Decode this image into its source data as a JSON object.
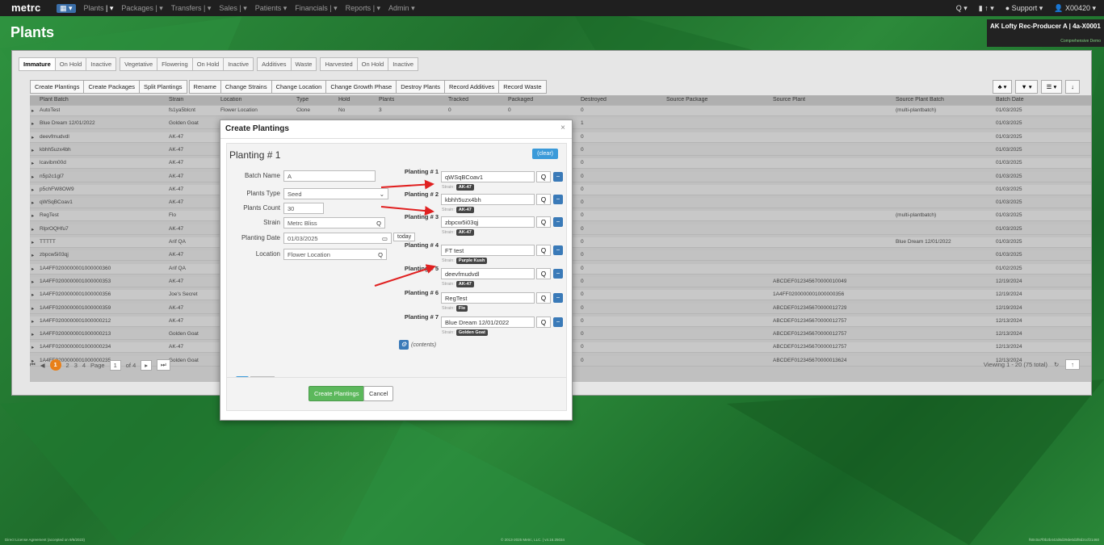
{
  "nav": {
    "logo": "metrc",
    "menu": [
      "Plants",
      "Packages",
      "Transfers",
      "Sales",
      "Patients",
      "Financials",
      "Reports",
      "Admin"
    ],
    "right": [
      "Q ▾",
      "▮ ↑ ▾",
      "● Support ▾",
      "👤 X00420 ▾"
    ]
  },
  "facility": {
    "name": "AK Lofty Rec-Producer A | 4a-X0001",
    "sub": "Comprehensive Demo"
  },
  "page_title": "Plants",
  "tabs": [
    "Immature",
    "On Hold",
    "Inactive",
    "Vegetative",
    "Flowering",
    "On Hold",
    "Inactive",
    "Additives",
    "Waste",
    "Harvested",
    "On Hold",
    "Inactive"
  ],
  "toolbar": [
    "Create Plantings",
    "Create Packages",
    "Split Plantings",
    "Rename",
    "Change Strains",
    "Change Location",
    "Change Growth Phase",
    "Destroy Plants",
    "Record Additives",
    "Record Waste"
  ],
  "toolbar_right": [
    "♣ ▾",
    "▼ ▾",
    "☰ ▾",
    "↓"
  ],
  "columns": [
    "Plant Batch",
    "Strain",
    "Location",
    "Type",
    "Hold",
    "Plants",
    "Tracked",
    "Packaged",
    "Destroyed",
    "Source Package",
    "Source Plant",
    "Source Plant Batch",
    "Batch Date"
  ],
  "rows": [
    {
      "batch": "AutoTest",
      "strain": "fs1ya5blcnt",
      "location": "Flower Location",
      "type": "Clone",
      "hold": "No",
      "plants": "3",
      "tracked": "0",
      "packaged": "0",
      "destroyed": "0",
      "src_plant": "",
      "src_batch": "(multi-plantbatch)",
      "date": "01/03/2025"
    },
    {
      "batch": "Blue Dream 12/01/2022",
      "strain": "Golden Goat",
      "location": "",
      "type": "",
      "hold": "",
      "plants": "",
      "tracked": "",
      "packaged": "",
      "destroyed": "1",
      "src_plant": "",
      "src_batch": "",
      "date": "01/03/2025"
    },
    {
      "batch": "deevfmudvdl",
      "strain": "AK-47",
      "destroyed": "0",
      "src_plant": "",
      "src_batch": "",
      "date": "01/03/2025"
    },
    {
      "batch": "kbhh5uzx4bh",
      "strain": "AK-47",
      "destroyed": "0",
      "src_plant": "",
      "src_batch": "",
      "date": "01/03/2025"
    },
    {
      "batch": "lcavibm00d",
      "strain": "AK-47",
      "destroyed": "0",
      "src_plant": "",
      "src_batch": "",
      "date": "01/03/2025"
    },
    {
      "batch": "n5p2c1gl7",
      "strain": "AK-47",
      "destroyed": "0",
      "src_plant": "",
      "src_batch": "",
      "date": "01/03/2025"
    },
    {
      "batch": "p5chFW8OW9",
      "strain": "AK-47",
      "destroyed": "0",
      "src_plant": "",
      "src_batch": "",
      "date": "01/03/2025"
    },
    {
      "batch": "qWSqBCoav1",
      "strain": "AK-47",
      "destroyed": "0",
      "src_plant": "",
      "src_batch": "",
      "date": "01/03/2025"
    },
    {
      "batch": "RegTest",
      "strain": "Flo",
      "destroyed": "0",
      "src_plant": "",
      "src_batch": "(multi-plantbatch)",
      "date": "01/03/2025"
    },
    {
      "batch": "RlprOQHfu7",
      "strain": "AK-47",
      "destroyed": "0",
      "src_plant": "",
      "src_batch": "",
      "date": "01/03/2025"
    },
    {
      "batch": "TTTTT",
      "strain": "Arif QA",
      "destroyed": "0",
      "src_plant": "",
      "src_batch": "Blue Dream 12/01/2022",
      "date": "01/03/2025"
    },
    {
      "batch": "zbpcw5i03qj",
      "strain": "AK-47",
      "destroyed": "0",
      "src_plant": "",
      "src_batch": "",
      "date": "01/03/2025"
    },
    {
      "batch": "1A4FF0200000001000000360",
      "strain": "Arif QA",
      "destroyed": "0",
      "src_plant": "",
      "src_batch": "",
      "date": "01/02/2025"
    },
    {
      "batch": "1A4FF0200000001000000353",
      "strain": "AK-47",
      "destroyed": "0",
      "src_plant": "ABCDEF012345670000010049",
      "src_batch": "",
      "date": "12/19/2024"
    },
    {
      "batch": "1A4FF0200000001000000356",
      "strain": "Joe's Secret",
      "destroyed": "0",
      "src_plant": "1A4FF0200000001000000356",
      "src_batch": "",
      "date": "12/19/2024"
    },
    {
      "batch": "1A4FF0200000001000000359",
      "strain": "AK-47",
      "destroyed": "0",
      "src_plant": "ABCDEF012345670000012729",
      "src_batch": "",
      "date": "12/19/2024"
    },
    {
      "batch": "1A4FF0200000001000000212",
      "strain": "AK-47",
      "destroyed": "0",
      "src_plant": "ABCDEF012345670000012757",
      "src_batch": "",
      "date": "12/13/2024"
    },
    {
      "batch": "1A4FF0200000001000000213",
      "strain": "Golden Goat",
      "destroyed": "0",
      "src_plant": "ABCDEF012345670000012757",
      "src_batch": "",
      "date": "12/13/2024"
    },
    {
      "batch": "1A4FF0200000001000000234",
      "strain": "AK-47",
      "destroyed": "0",
      "src_plant": "ABCDEF012345670000012757",
      "src_batch": "",
      "date": "12/13/2024"
    },
    {
      "batch": "1A4FF0200000001000000235",
      "strain": "Golden Goat",
      "destroyed": "0",
      "src_plant": "ABCDEF012345670000013624",
      "src_batch": "",
      "date": "12/13/2024"
    }
  ],
  "pager": {
    "pages": [
      "2",
      "3",
      "4"
    ],
    "current": "1",
    "page_label": "Page",
    "page_value": "1",
    "of": "of 4",
    "viewing": "Viewing 1 - 20 (75 total)"
  },
  "modal": {
    "title": "Create Plantings",
    "close": "×",
    "planting_title": "Planting # 1",
    "clear": "(clear)",
    "fields": [
      {
        "label": "Batch Name",
        "value": "A",
        "icon": ""
      },
      {
        "label": "Plants Type",
        "value": "Seed",
        "icon": "⌄"
      },
      {
        "label": "Plants Count",
        "value": "30",
        "icon": ""
      },
      {
        "label": "Strain",
        "value": "Metrc Bliss",
        "icon": "Q"
      },
      {
        "label": "Planting Date",
        "value": "01/03/2025",
        "icon": "▭"
      },
      {
        "label": "Location",
        "value": "Flower Location",
        "icon": "Q"
      }
    ],
    "today": "today",
    "plantings": [
      {
        "label": "Planting # 1",
        "value": "qWSqBCoav1",
        "strain": "AK-47"
      },
      {
        "label": "Planting # 2",
        "value": "kbhh5uzx4bh",
        "strain": "AK-47"
      },
      {
        "label": "Planting # 3",
        "value": "zbpcw5i03qj",
        "strain": "AK-47"
      },
      {
        "label": "Planting # 4",
        "value": "FT test",
        "strain": "Purple Kush"
      },
      {
        "label": "Planting # 5",
        "value": "deevfmudvdl",
        "strain": "AK-47"
      },
      {
        "label": "Planting # 6",
        "value": "RegTest",
        "strain": "Flo"
      },
      {
        "label": "Planting # 7",
        "value": "Blue Dream 12/01/2022",
        "strain": "Golden Goat"
      }
    ],
    "strain_label": "Strain:",
    "contents": "(contents)",
    "add_count": "1",
    "create_btn": "Create Plantings",
    "cancel_btn": "Cancel"
  },
  "footer": {
    "left": "Direct License Agreement (accepted on 9/6/2023)",
    "center": "© 2013-2025 Metrc, LLC. | v4.16.25034",
    "right": "f60c0a7f0b2b442d6d29de0d2f8d2ccf21460"
  }
}
